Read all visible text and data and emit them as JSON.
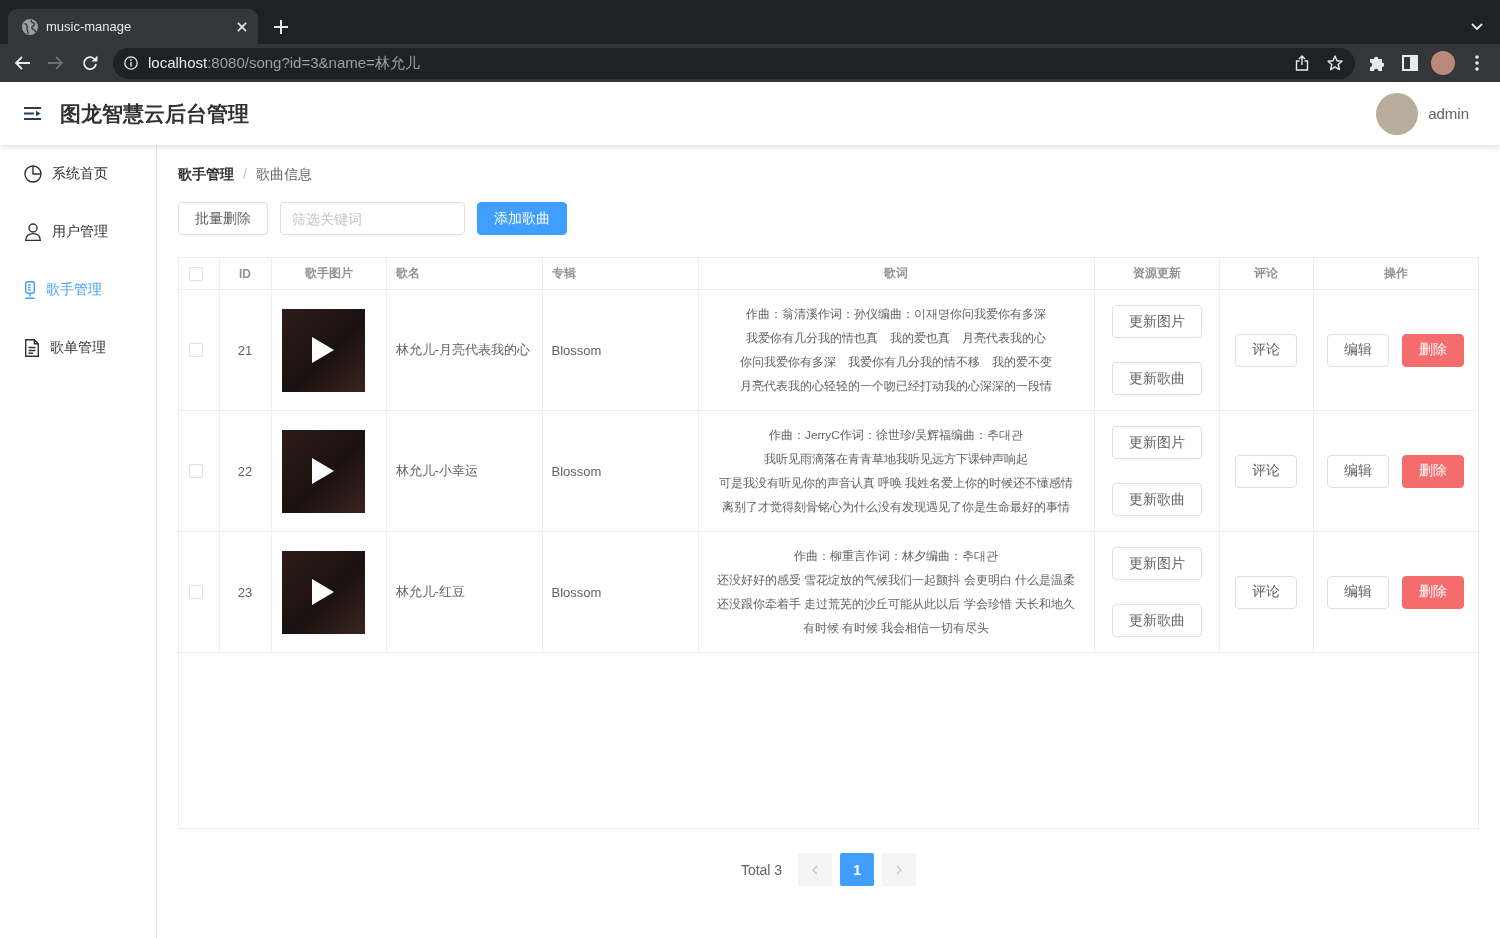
{
  "browser": {
    "tab": {
      "title": "music-manage"
    },
    "url_host": "localhost",
    "url_rest": ":8080/song?id=3&name=林允儿",
    "forward": {
      "disabled": true
    }
  },
  "header": {
    "title": "图龙智慧云后台管理",
    "user": "admin"
  },
  "sidebar": {
    "items": [
      {
        "label": "系统首页",
        "selected": false
      },
      {
        "label": "用户管理",
        "selected": false
      },
      {
        "label": "歌手管理",
        "selected": true
      },
      {
        "label": "歌单管理",
        "selected": false
      }
    ]
  },
  "breadcrumb": {
    "items": [
      "歌手管理",
      "歌曲信息"
    ],
    "separator": "/"
  },
  "toolbar": {
    "batch_delete": "批量删除",
    "search": {
      "placeholder": "筛选关键词"
    },
    "add": "添加歌曲"
  },
  "table": {
    "select_all": {
      "checked": false
    },
    "columns": [
      "ID",
      "歌手图片",
      "歌名",
      "专辑",
      "歌词",
      "资源更新",
      "评论",
      "操作"
    ],
    "rows": [
      {
        "checked": false,
        "id": "21",
        "song": "林允儿-月亮代表我的心",
        "album": "Blossom",
        "lyrics": [
          "作曲：翁清溪作词：孙仪编曲：이재명你问我爱你有多深",
          "我爱你有几分我的情也真　我的爱也真　月亮代表我的心",
          "你问我爱你有多深　我爱你有几分我的情不移　我的爱不变",
          "月亮代表我的心轻轻的一个吻已经打动我的心深深的一段情"
        ],
        "resource_actions": [
          "更新图片",
          "更新歌曲"
        ],
        "comment": "评论",
        "actions": [
          {
            "label": "编辑",
            "kind": "default"
          },
          {
            "label": "删除",
            "kind": "danger"
          }
        ]
      },
      {
        "checked": false,
        "id": "22",
        "song": "林允儿-小幸运",
        "album": "Blossom",
        "lyrics": [
          "作曲：JerryC作词：徐世珍/吴辉福编曲：추대관",
          "我听见雨滴落在青青草地我听见远方下课钟声响起",
          "可是我没有听见你的声音认真 呼唤 我姓名爱上你的时候还不懂感情",
          "离别了才觉得刻骨铭心为什么没有发现遇见了你是生命最好的事情"
        ],
        "resource_actions": [
          "更新图片",
          "更新歌曲"
        ],
        "comment": "评论",
        "actions": [
          {
            "label": "编辑",
            "kind": "default"
          },
          {
            "label": "删除",
            "kind": "danger"
          }
        ]
      },
      {
        "checked": false,
        "id": "23",
        "song": "林允儿-红豆",
        "album": "Blossom",
        "lyrics": [
          "作曲：柳重言作词：林夕编曲：추대관",
          "还没好好的感受 雪花绽放的气候我们一起颤抖 会更明白 什么是温柔",
          "还没跟你牵着手 走过荒芜的沙丘可能从此以后 学会珍惜 天长和地久",
          "有时候 有时候 我会相信一切有尽头"
        ],
        "resource_actions": [
          "更新图片",
          "更新歌曲"
        ],
        "comment": "评论",
        "actions": [
          {
            "label": "编辑",
            "kind": "default"
          },
          {
            "label": "删除",
            "kind": "danger"
          }
        ]
      }
    ]
  },
  "pagination": {
    "total": "Total 3",
    "prev": {
      "disabled": true
    },
    "pages": [
      {
        "label": "1",
        "selected": true
      }
    ],
    "next": {
      "disabled": true
    }
  }
}
